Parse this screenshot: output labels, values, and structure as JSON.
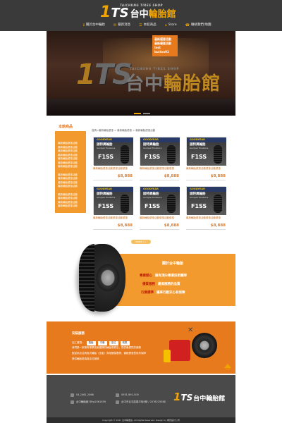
{
  "header": {
    "logo_mark": "1",
    "logo_ts": "TS",
    "logo_cn": "台中",
    "logo_cn_accent": "輪胎館",
    "logo_sub": "TAICHUNG TIRES SHOP",
    "nav": [
      {
        "label": "關於台中輪胎",
        "icon": "ℹ"
      },
      {
        "label": "最新消息",
        "icon": "✉"
      },
      {
        "label": "本館商品",
        "icon": "☰"
      },
      {
        "label": "Store",
        "icon": "⌂"
      },
      {
        "label": "聯絡我們/地圖",
        "icon": "☎"
      }
    ]
  },
  "hero": {
    "sign_logo": "1",
    "sign_ts": "TS",
    "sign_cn": "台中",
    "sign_cn_accent": "輪胎館",
    "sign_sub": "TAICHUNG TIRES SHOP",
    "promo": [
      "最新優惠活動",
      "最新優惠活動",
      "test button01"
    ]
  },
  "sidebar": {
    "title": "本館商品",
    "groups": [
      [
        "最新輪胎優惠活動",
        "最新輪胎優惠活動",
        "最新輪胎優惠活動",
        "最新輪胎優惠活動",
        "最新輪胎優惠活動",
        "最新輪胎優惠活動",
        "最新輪胎優惠活動"
      ],
      [
        "最新輪胎優惠活動",
        "最新輪胎優惠活動",
        "最新輪胎優惠活動",
        "最新輪胎優惠活動"
      ],
      [
        "最新輪胎優惠活動",
        "最新輪胎優惠活動",
        "最新輪胎優惠活動",
        "最新輪胎優惠活動"
      ]
    ]
  },
  "breadcrumb": "首頁>最新輪胎優惠 > 最新輪胎優惠 > 最新輪胎優惠活動",
  "products": [
    {
      "brand": "GOODYEAR",
      "cn": "固特異輪胎",
      "sub": "Goodyear Excellence",
      "model": "F1SS",
      "name": "最新輪胎優惠活動優惠活動優惠",
      "price": "$8,888"
    },
    {
      "brand": "GOODYEAR",
      "cn": "固特異輪胎",
      "sub": "Goodyear Excellence",
      "model": "F1SS",
      "name": "最新輪胎優惠活動優惠活動優惠",
      "price": "$8,888"
    },
    {
      "brand": "GOODYEAR",
      "cn": "固特異輪胎",
      "sub": "Goodyear Excellence",
      "model": "F1SS",
      "name": "最新輪胎優惠活動優惠活動優惠",
      "price": "$8,888"
    },
    {
      "brand": "GOODYEAR",
      "cn": "固特異輪胎",
      "sub": "Goodyear Excellence",
      "model": "F1SS",
      "name": "最新輪胎優惠活動優惠活動優惠",
      "price": "$8,888"
    },
    {
      "brand": "GOODYEAR",
      "cn": "固特異輪胎",
      "sub": "Goodyear Excellence",
      "model": "F1SS",
      "name": "最新輪胎優惠活動優惠活動優惠",
      "price": "$8,888"
    },
    {
      "brand": "GOODYEAR",
      "cn": "固特異輪胎",
      "sub": "Goodyear Excellence",
      "model": "F1SS",
      "name": "最新輪胎優惠活動優惠活動優惠",
      "price": "$8,888"
    }
  ],
  "more_label": "MORE >>",
  "about": {
    "title": "關於台中輪胎",
    "lines": [
      {
        "a": "專業開心",
        "b": "擁有頂尖專業技術團隊"
      },
      {
        "a": "優質服務",
        "b": "最高服務的品質"
      },
      {
        "a": "行業標準",
        "b": "讓車行駛安心有保障"
      }
    ]
  },
  "service": {
    "title": "安裝服務",
    "label": "加工選項：",
    "buttons": [
      "換胎",
      "平衡",
      "定位",
      "氮氣"
    ],
    "lines": [
      "我們是一家擁有專業技術團隊的輪胎專賣店，提供最優質的服務",
      "歡迎來店洽詢各式輪胎（含胎）與相關保養等，價格實惠售後有保障",
      "提供輪胎更換與定位服務"
    ],
    "top_label": "TOP"
  },
  "footer": {
    "phone": "04-2461-2066",
    "fax": "0931-691-505",
    "line": "台中輪胎館 @tw2061059",
    "address": "台中市北屯區路平街8號 / 2076225588",
    "logo_mark": "1",
    "logo_ts": "TS",
    "logo_cn": "台中輪胎館",
    "copyright": "Copyright © 2021 台中輪胎館. All Rights Reserved. Design by 網頁設計公司"
  },
  "colors": {
    "accent": "#e87a1e",
    "gold": "#f0a400",
    "dark": "#3a3a3a"
  }
}
